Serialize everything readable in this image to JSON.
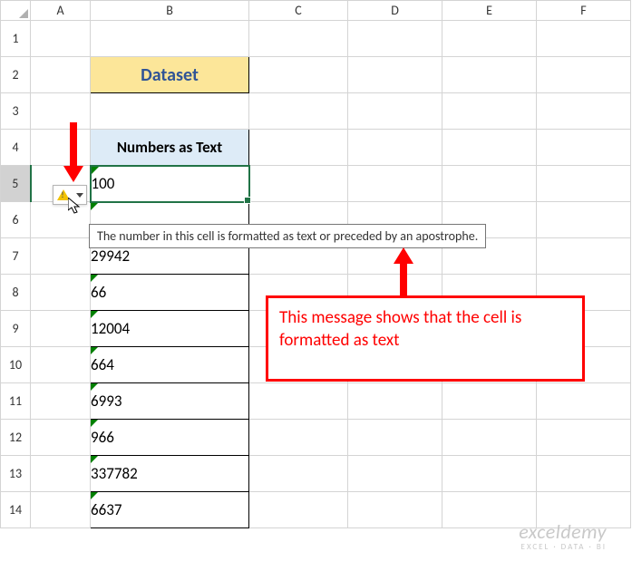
{
  "columns": [
    "A",
    "B",
    "C",
    "D",
    "E",
    "F"
  ],
  "rows": [
    "1",
    "2",
    "3",
    "4",
    "5",
    "6",
    "7",
    "8",
    "9",
    "10",
    "11",
    "12",
    "13",
    "14"
  ],
  "title_cell": "Dataset",
  "header_cell": "Numbers as Text",
  "values": [
    "100",
    "",
    "29942",
    "66",
    "12004",
    "664",
    "6993",
    "966",
    "337782",
    "6637"
  ],
  "tooltip_text": "The number in this cell is formatted as text or preceded by an apostrophe.",
  "callout_text": "This message shows that the cell is formatted as text",
  "watermark_main": "exceldemy",
  "watermark_sub": "EXCEL · DATA · BI",
  "chart_data": {
    "type": "table",
    "title": "Dataset",
    "columns": [
      "Numbers as Text"
    ],
    "rows": [
      [
        "100"
      ],
      [
        "29942"
      ],
      [
        "66"
      ],
      [
        "12004"
      ],
      [
        "664"
      ],
      [
        "6993"
      ],
      [
        "966"
      ],
      [
        "337782"
      ],
      [
        "6637"
      ]
    ],
    "note": "Cell B5 selected; values stored as text with error indicator"
  }
}
